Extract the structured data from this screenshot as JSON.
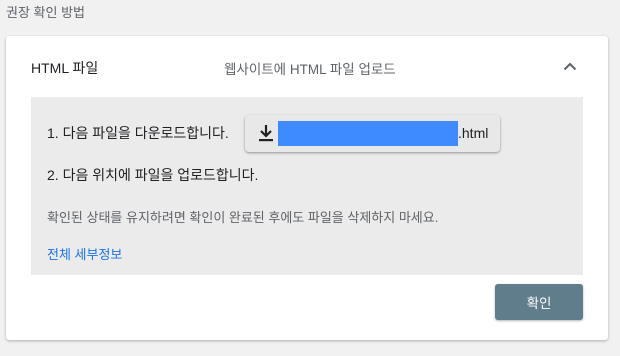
{
  "section": {
    "label": "권장 확인 방법"
  },
  "method": {
    "name": "HTML 파일",
    "description": "웹사이트에 HTML 파일 업로드",
    "collapse_icon": "chevron-up-icon"
  },
  "steps": {
    "step1": "1. 다음 파일을 다운로드합니다.",
    "step2": "2. 다음 위치에 파일을 업로드합니다."
  },
  "download": {
    "icon": "download-icon",
    "extension": ".html",
    "redaction_color": "#3d8bff"
  },
  "note": "확인된 상태를 유지하려면 확인이 완료된 후에도 파일을 삭제하지 마세요.",
  "details_link": "전체 세부정보",
  "confirm_button": "확인",
  "colors": {
    "accent_link": "#1a73e8",
    "button": "#607d8b",
    "panel": "#ebebeb"
  }
}
